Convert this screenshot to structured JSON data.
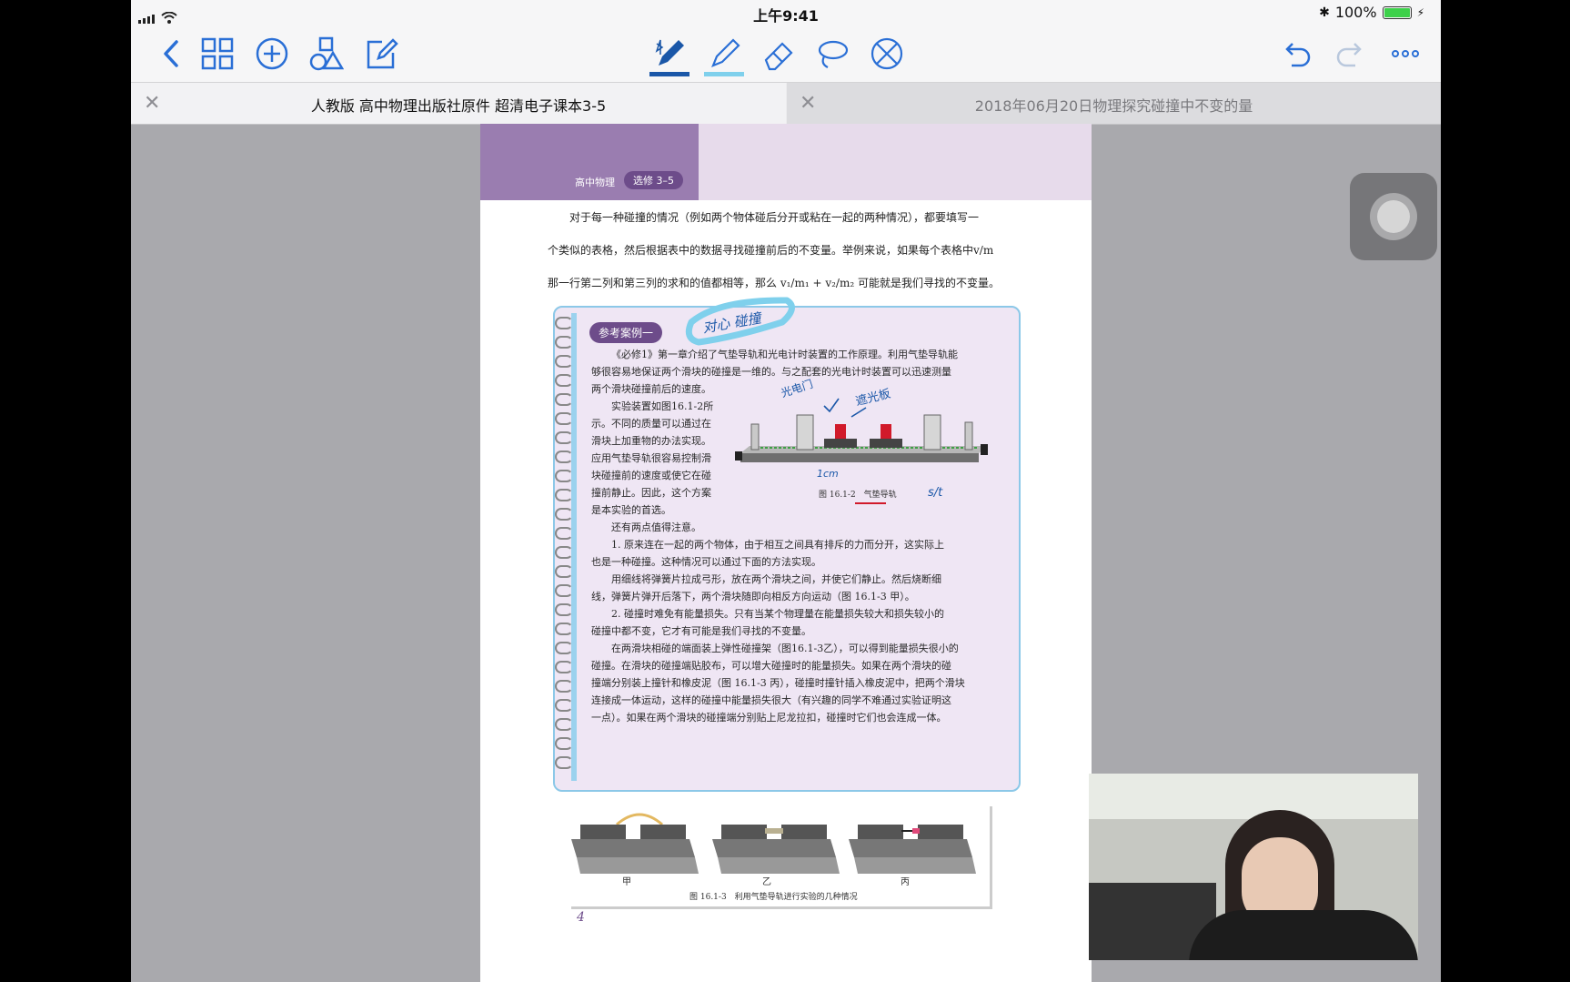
{
  "status_bar": {
    "time": "上午9:41",
    "battery_percent": "100%",
    "battery_level": 1.0
  },
  "toolbar": {
    "left_icons": [
      "back-chevron-icon",
      "thumbnail-grid-icon",
      "add-icon",
      "shapes-icon",
      "edit-note-icon"
    ],
    "center_tools": [
      "bluetooth-pen-icon",
      "highlighter-icon",
      "eraser-icon",
      "lasso-icon",
      "disable-touch-icon"
    ],
    "right_icons": [
      "undo-icon",
      "redo-icon",
      "more-icon"
    ],
    "pen_color": "#1a57a8",
    "highlighter_color": "#7fd0ec"
  },
  "tabs": [
    {
      "title": "人教版 高中物理出版社原件 超清电子课本3-5",
      "active": true
    },
    {
      "title": "2018年06月20日物理探究碰撞中不变的量",
      "active": false
    }
  ],
  "document": {
    "header": {
      "subject": "高中物理",
      "volume": "选修 3–5"
    },
    "intro_lines": [
      "对于每一种碰撞的情况（例如两个物体碰后分开或粘在一起的两种情况），都要填写一",
      "个类似的表格，然后根据表中的数据寻找碰撞前后的不变量。举例来说，如果每个表格中v/m",
      "那一行第二列和第三列的求和的值都相等，那么 v₁/m₁ + v₂/m₂ 可能就是我们寻找的不变量。"
    ],
    "box": {
      "tag": "参考案例一",
      "handwritten_note": "对心 碰撞",
      "lines_top": [
        "《必修1》第一章介绍了气垫导轨和光电计时装置的工作原理。利用气垫导轨能",
        "够很容易地保证两个滑块的碰撞是一维的。与之配套的光电计时装置可以迅速测量",
        "两个滑块碰撞前后的速度。"
      ],
      "lines_left": [
        "实验装置如图16.1-2所",
        "示。不同的质量可以通过在",
        "滑块上加重物的办法实现。",
        "应用气垫导轨很容易控制滑",
        "块碰撞前的速度或使它在碰",
        "撞前静止。因此，这个方案",
        "是本实验的首选。",
        "还有两点值得注意。"
      ],
      "figure_caption": "图 16.1-2　气垫导轨",
      "figure_annotations": [
        "光电门",
        "遮光板",
        "1cm",
        "s/t"
      ],
      "lines_bottom": [
        "1. 原来连在一起的两个物体，由于相互之间具有排斥的力而分开，这实际上",
        "也是一种碰撞。这种情况可以通过下面的方法实现。",
        "用细线将弹簧片拉成弓形，放在两个滑块之间，并使它们静止。然后烧断细",
        "线，弹簧片弹开后落下，两个滑块随即向相反方向运动（图 16.1-3 甲）。",
        "2. 碰撞时难免有能量损失。只有当某个物理量在能量损失较大和损失较小的",
        "碰撞中都不变，它才有可能是我们寻找的不变量。",
        "在两滑块相碰的端面装上弹性碰撞架（图16.1-3乙），可以得到能量损失很小的",
        "碰撞。在滑块的碰撞端贴胶布，可以增大碰撞时的能量损失。如果在两个滑块的碰",
        "撞端分别装上撞针和橡皮泥（图 16.1-3 丙），碰撞时撞针插入橡皮泥中，把两个滑块",
        "连接成一体运动，这样的碰撞中能量损失很大（有兴趣的同学不难通过实验证明这",
        "一点）。如果在两个滑块的碰撞端分别贴上尼龙拉扣，碰撞时它们也会连成一体。"
      ]
    },
    "bottom_figure": {
      "labels": [
        "甲",
        "乙",
        "丙"
      ],
      "caption": "图 16.1-3　利用气垫导轨进行实验的几种情况"
    },
    "page_number": "4"
  },
  "overlays": {
    "assistive_touch": "assistive-touch-button",
    "webcam": "presenter-webcam-video"
  }
}
